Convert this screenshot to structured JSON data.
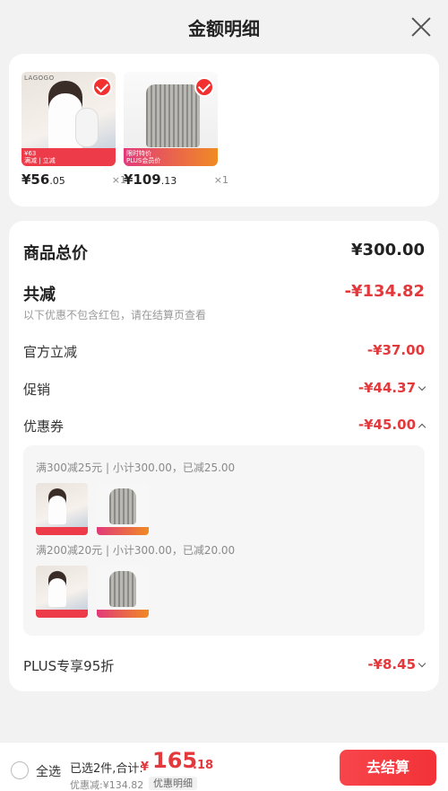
{
  "header": {
    "title": "金额明细"
  },
  "products": [
    {
      "brand": "LAGOGO",
      "price_int": "¥56",
      "price_dec": ".05",
      "qty": "×1",
      "promo_line1": "¥63",
      "promo_line2": "满减 | 立减"
    },
    {
      "brand": "",
      "price_int": "¥109",
      "price_dec": ".13",
      "qty": "×1",
      "promo_line1": "限时特价",
      "promo_line2": "PLUS会员价"
    }
  ],
  "summary": {
    "total_label": "商品总价",
    "total_value": "¥300.00",
    "reduce_label": "共减",
    "reduce_value": "-¥134.82",
    "note": "以下优惠不包含红包，请在结算页查看",
    "official_label": "官方立减",
    "official_value": "-¥37.00",
    "promo_label": "促销",
    "promo_value": "-¥44.37",
    "coupon_label": "优惠券",
    "coupon_value": "-¥45.00",
    "coupon_lines": [
      "满300减25元 | 小计300.00，已减25.00",
      "满200减20元 | 小计300.00，已减20.00"
    ],
    "plus_label": "PLUS专享95折",
    "plus_value": "-¥8.45"
  },
  "bottom": {
    "select_all": "全选",
    "selected": "已选2件,合计:",
    "total_symbol": "¥",
    "total_int": "165",
    "total_dec": ".18",
    "discount": "优惠减:¥134.82",
    "detail_btn": "优惠明细",
    "checkout": "去结算"
  },
  "colors": {
    "accent": "#e4393c",
    "checkout": "#f23237"
  }
}
